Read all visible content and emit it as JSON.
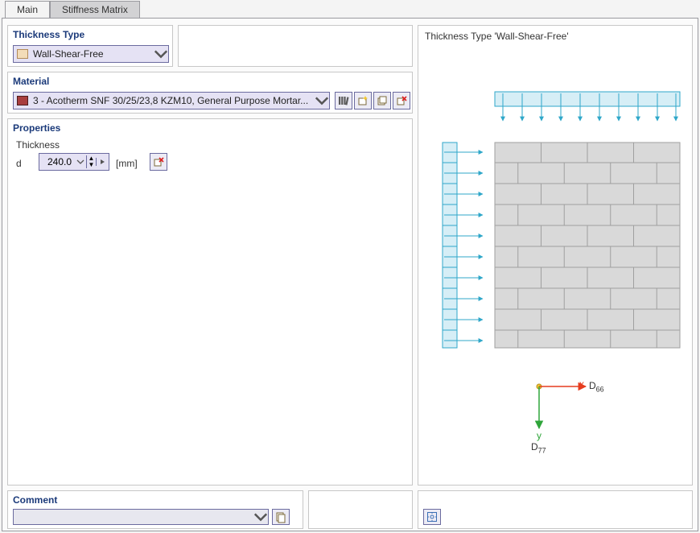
{
  "tabs": {
    "main": "Main",
    "stiff": "Stiffness Matrix"
  },
  "thicknessType": {
    "title": "Thickness Type",
    "value": "Wall-Shear-Free"
  },
  "material": {
    "title": "Material",
    "value": "3 - Acotherm SNF 30/25/23,8 KZM10, General Purpose Mortar..."
  },
  "properties": {
    "title": "Properties",
    "thicknessLabel": "Thickness",
    "symbol": "d",
    "value": "240.0",
    "unit": "[mm]"
  },
  "comment": {
    "title": "Comment",
    "value": ""
  },
  "preview": {
    "title": "Thickness Type  'Wall-Shear-Free'",
    "xAxis": "x",
    "yAxis": "y",
    "d66_base": "D",
    "d66_sub": "66",
    "d77_base": "D",
    "d77_sub": "77"
  },
  "icons": {
    "library": "library-icon",
    "new": "new-icon",
    "dup": "duplicate-icon",
    "del": "delete-icon",
    "delProp": "delete-prop-icon",
    "pick": "pick-icon",
    "zoom": "zoom-fit-icon"
  }
}
